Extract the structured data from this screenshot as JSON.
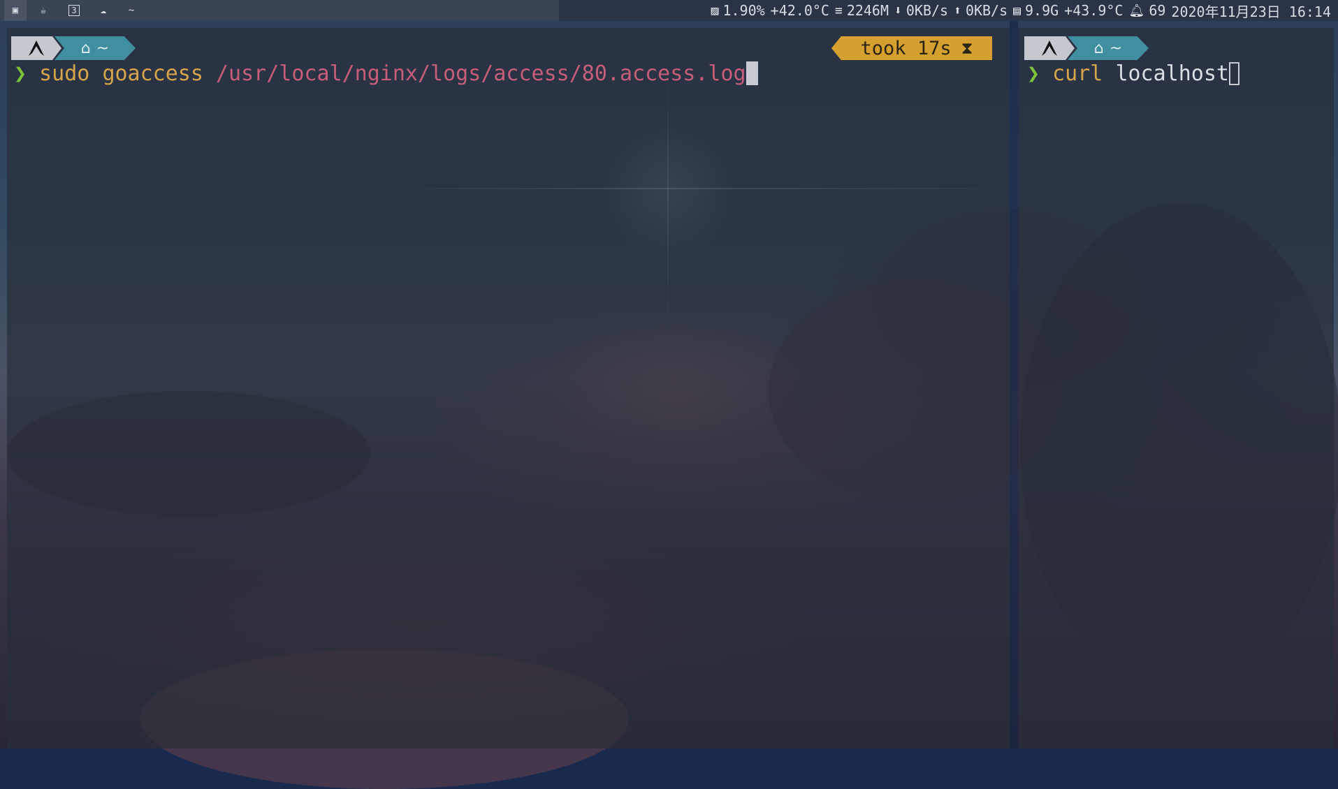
{
  "statusbar": {
    "workspaces": [
      {
        "icon": "terminal-icon",
        "glyph": "▣",
        "active": true
      },
      {
        "icon": "coffee-icon",
        "glyph": "☕",
        "active": false
      },
      {
        "icon": "number-3-icon",
        "glyph": "3",
        "active": false
      },
      {
        "icon": "cloud-icon",
        "glyph": "☁",
        "active": false
      },
      {
        "icon": "tilde-icon",
        "glyph": "~",
        "active": false
      }
    ],
    "cpu_icon": "chart-icon",
    "cpu_usage": "1.90%",
    "cpu_temp": "+42.0°C",
    "mem_icon": "database-icon",
    "memory": "2246M",
    "down_icon": "arrow-down-icon",
    "net_down": "0KB/s",
    "up_icon": "arrow-up-icon",
    "net_up": "0KB/s",
    "disk_icon": "disk-icon",
    "disk": "9.9G",
    "gpu_temp": "+43.9°C",
    "bell_icon": "bell-icon",
    "notifications": "69",
    "datetime": "2020年11月23日 16:14"
  },
  "left_terminal": {
    "prompt_os_icon": "arch-logo-icon",
    "prompt_home_icon": "home-icon",
    "prompt_dir": "~",
    "took": "took 17s",
    "took_icon": "hourglass-icon",
    "prompt_char": "❯",
    "command_word1": "sudo",
    "command_word2": "goaccess",
    "command_arg": "/usr/local/nginx/logs/access/80.access.log"
  },
  "right_terminal": {
    "prompt_os_icon": "arch-logo-icon",
    "prompt_home_icon": "home-icon",
    "prompt_dir": "~",
    "prompt_char": "❯",
    "command_word1": "curl",
    "command_arg": "localhost"
  },
  "colors": {
    "prompt_chevron": "#7ec23a",
    "command_yellow": "#d6a44a",
    "path_pink": "#c65e7a",
    "took_bg": "#d6a030",
    "home_bg": "#3f8fa0"
  }
}
